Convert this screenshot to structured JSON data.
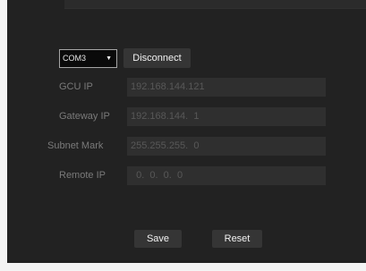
{
  "serial": {
    "port_selected": "COM3",
    "connect_button_label": "Disconnect"
  },
  "network": {
    "fields": [
      {
        "label": "GCU IP",
        "value": "192.168.144.121"
      },
      {
        "label": "Gateway IP",
        "value": "192.168.144.  1"
      },
      {
        "label": "Subnet Mark",
        "value": "255.255.255.  0"
      },
      {
        "label": "Remote IP",
        "value": "  0.  0.  0.  0"
      }
    ]
  },
  "actions": {
    "save_label": "Save",
    "reset_label": "Reset"
  },
  "icons": {
    "dropdown_arrow": "▼"
  },
  "colors": {
    "panel_background": "#222222",
    "button_background": "#353535",
    "field_background": "#2f2f2f"
  }
}
